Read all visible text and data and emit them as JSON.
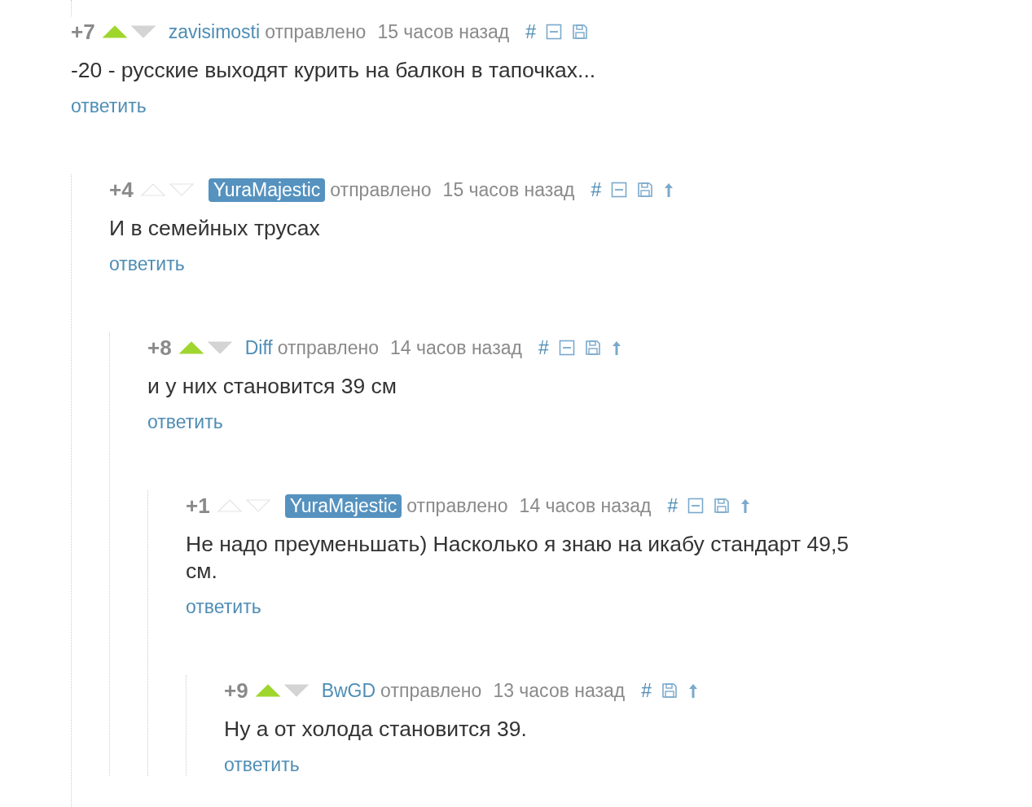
{
  "comments": [
    {
      "score": "+7",
      "voting_disabled": false,
      "author": "zavisimosti",
      "author_highlighted": false,
      "sent": "отправлено",
      "time": "15 часов назад",
      "permalink": "#",
      "collapse": true,
      "save": true,
      "parent": false,
      "text": "-20 - русские выходят курить на балкон в тапочках...",
      "reply": "ответить",
      "children": [
        {
          "score": "+4",
          "voting_disabled": true,
          "author": "YuraMajestic",
          "author_highlighted": true,
          "sent": "отправлено",
          "time": "15 часов назад",
          "permalink": "#",
          "collapse": true,
          "save": true,
          "parent": true,
          "text": "И в семейных трусах",
          "reply": "ответить",
          "children": [
            {
              "score": "+8",
              "voting_disabled": false,
              "author": "Diff",
              "author_highlighted": false,
              "sent": "отправлено",
              "time": "14 часов назад",
              "permalink": "#",
              "collapse": true,
              "save": true,
              "parent": true,
              "text": "и у них становится 39 см",
              "reply": "ответить",
              "children": [
                {
                  "score": "+1",
                  "voting_disabled": true,
                  "author": "YuraMajestic",
                  "author_highlighted": true,
                  "sent": "отправлено",
                  "time": "14 часов назад",
                  "permalink": "#",
                  "collapse": true,
                  "save": true,
                  "parent": true,
                  "text": "Не надо преуменьшать) Насколько я знаю на икабу стандарт 49,5 см.",
                  "reply": "ответить",
                  "children": [
                    {
                      "score": "+9",
                      "voting_disabled": false,
                      "author": "BwGD",
                      "author_highlighted": false,
                      "sent": "отправлено",
                      "time": "13 часов назад",
                      "permalink": "#",
                      "collapse": false,
                      "save": true,
                      "parent": true,
                      "text": "Ну а от холода становится 39.",
                      "reply": "ответить"
                    }
                  ]
                }
              ]
            }
          ]
        }
      ]
    }
  ]
}
